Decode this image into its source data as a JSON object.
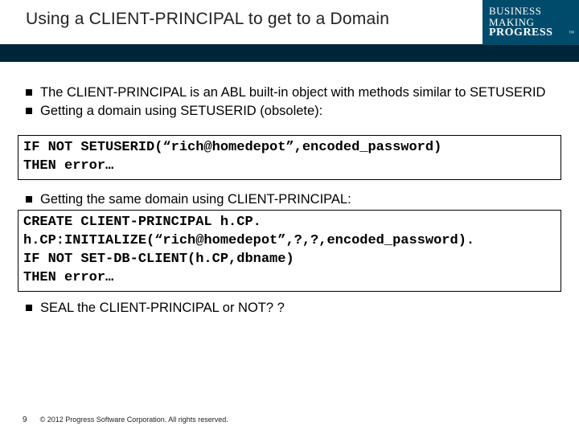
{
  "header": {
    "title": "Using a CLIENT-PRINCIPAL to get to a Domain",
    "logo": {
      "l1": "BUSINESS",
      "l2": "MAKING",
      "l3": "PROGRESS",
      "tm": "™"
    }
  },
  "bullets": {
    "b1": "The CLIENT-PRINCIPAL is an ABL built-in object with methods similar to SETUSERID",
    "b2": "Getting a domain using SETUSERID (obsolete):",
    "b3": "Getting the same domain using CLIENT-PRINCIPAL:",
    "b4": "SEAL the CLIENT-PRINCIPAL or NOT? ?"
  },
  "code": {
    "c1": "IF NOT SETUSERID(“rich@homedepot”,encoded_password)\nTHEN error…",
    "c2": "CREATE CLIENT-PRINCIPAL h.CP.\nh.CP:INITIALIZE(“rich@homedepot”,?,?,encoded_password).\nIF NOT SET-DB-CLIENT(h.CP,dbname)\nTHEN error…"
  },
  "footer": {
    "page": "9",
    "copyright": "© 2012 Progress Software Corporation. All rights reserved."
  }
}
